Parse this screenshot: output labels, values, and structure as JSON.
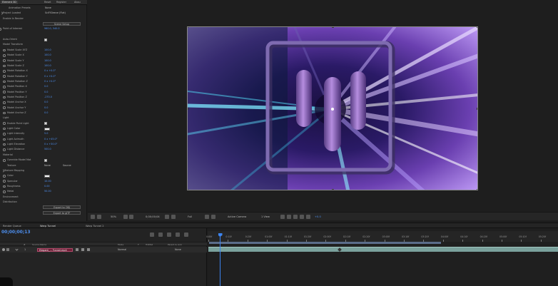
{
  "effect_controls": {
    "tabs": [
      "Element 3D",
      "Reset",
      "Register",
      "Abou"
    ],
    "rows": [
      {
        "label": "Animation Presets",
        "value": "None",
        "style": "white",
        "indent": 10
      },
      {
        "label": "Project Loaded",
        "value": "SciFiSleeve (Flat)",
        "style": "white",
        "indent": 2,
        "twirl": true
      },
      {
        "label": "Enable In Render",
        "value": "",
        "style": "",
        "indent": 2
      },
      {
        "label": "",
        "button": "Scene Setup",
        "indent": 2
      },
      {
        "label": "Point of Interest",
        "value": "960.0, 540.0",
        "style": "blue",
        "indent": 2,
        "stopwatch": true
      },
      {
        "label": "",
        "value": "",
        "style": "",
        "indent": 2
      },
      {
        "label": "Auto-Orient",
        "checkbox": true,
        "indent": 2
      },
      {
        "label": "Model Transform",
        "value": "",
        "style": "",
        "indent": 2
      },
      {
        "label": "Model Scale XYZ",
        "value": "100.0",
        "style": "blue",
        "indent": 8,
        "stopwatch": true
      },
      {
        "label": "Model Scale X",
        "value": "100.0",
        "style": "blue",
        "indent": 8,
        "stopwatch": true
      },
      {
        "label": "Model Scale Y",
        "value": "100.0",
        "style": "blue",
        "indent": 8,
        "stopwatch": true
      },
      {
        "label": "Model Scale Z",
        "value": "100.0",
        "style": "blue",
        "indent": 8,
        "stopwatch": true
      },
      {
        "label": "Model Rotation X",
        "value": "0 x +0.0°",
        "style": "blue",
        "indent": 8,
        "stopwatch": true
      },
      {
        "label": "Model Rotation Y",
        "value": "0 x +0.0°",
        "style": "blue",
        "indent": 8,
        "stopwatch": true
      },
      {
        "label": "Model Rotation Z",
        "value": "0 x +0.0°",
        "style": "blue",
        "indent": 8,
        "stopwatch": true
      },
      {
        "label": "Model Position X",
        "value": "0.0",
        "style": "blue",
        "indent": 8,
        "stopwatch": true
      },
      {
        "label": "Model Position Y",
        "value": "0.0",
        "style": "blue",
        "indent": 8,
        "stopwatch": true
      },
      {
        "label": "Model Position Z",
        "value": "-270.0",
        "style": "blue",
        "indent": 8,
        "stopwatch": true
      },
      {
        "label": "Model Anchor X",
        "value": "0.0",
        "style": "blue",
        "indent": 8,
        "stopwatch": true
      },
      {
        "label": "Model Anchor Y",
        "value": "0.0",
        "style": "blue",
        "indent": 8,
        "stopwatch": true
      },
      {
        "label": "Model Anchor Z",
        "value": "0.0",
        "style": "blue",
        "indent": 8,
        "stopwatch": true
      },
      {
        "label": "Light",
        "value": "",
        "style": "",
        "indent": 2
      },
      {
        "label": "Enable Point Light",
        "checkbox": true,
        "indent": 8,
        "stopwatch": true
      },
      {
        "label": "Light Color",
        "swatch": true,
        "indent": 8,
        "stopwatch": true
      },
      {
        "label": "Light Intensity",
        "value": "5.0",
        "style": "blue",
        "indent": 8,
        "stopwatch": true
      },
      {
        "label": "Light Azimuth",
        "value": "0 x +45.0°",
        "style": "blue",
        "indent": 8,
        "stopwatch": true
      },
      {
        "label": "Light Elevation",
        "value": "0 x +30.0°",
        "style": "blue",
        "indent": 8,
        "stopwatch": true
      },
      {
        "label": "Light Distance",
        "value": "500.0",
        "style": "blue",
        "indent": 8,
        "stopwatch": true
      },
      {
        "label": "Material",
        "value": "",
        "style": "",
        "indent": 2
      },
      {
        "label": "Override Model Mat",
        "checkbox": true,
        "indent": 8,
        "stopwatch": true
      },
      {
        "label": "Texture",
        "dropdowns": [
          "None",
          "Source"
        ],
        "indent": 8
      },
      {
        "label": "Texture Mapping",
        "value": "",
        "style": "",
        "indent": 4,
        "twirl": true
      },
      {
        "label": "Color",
        "swatch": true,
        "indent": 8,
        "stopwatch": true
      },
      {
        "label": "Specular",
        "value": "10.00",
        "style": "blue",
        "indent": 8,
        "stopwatch": true
      },
      {
        "label": "Roughness",
        "value": "0.00",
        "style": "blue",
        "indent": 8,
        "stopwatch": true
      },
      {
        "label": "Metal",
        "value": "50.00",
        "style": "blue",
        "indent": 8,
        "stopwatch": true
      },
      {
        "label": "Environment",
        "value": "",
        "style": "",
        "indent": 2
      },
      {
        "label": "Distribution",
        "value": "",
        "style": "",
        "indent": 2
      },
      {
        "label": "",
        "button": "Export to OBJ",
        "indent": 2
      },
      {
        "label": "",
        "button": "Export to glTF",
        "indent": 2
      }
    ]
  },
  "viewer": {
    "toolbar": {
      "zoom": "50%",
      "timecode": "0;00;00;04",
      "resolution": "Full",
      "camera": "Active Camera",
      "views": "1 View",
      "exposure": "+0.0"
    }
  },
  "timeline": {
    "tabs": [
      "Render Queue",
      "Warp Tunnel",
      "Warp Tunnel 2"
    ],
    "timecode": "00;00;00;13",
    "columns": [
      "#",
      "Source Name",
      "Mode",
      "T",
      "TrkMat",
      "Parent & Link"
    ],
    "layer": {
      "number": "1",
      "name": "Elegant_... Tunnel.mp4",
      "mode": "Normal",
      "trkmat": "",
      "parent": "None"
    },
    "ruler_labels": [
      "0:00f",
      "0:10f",
      "0:20f",
      "01:00f",
      "01:10f",
      "01:20f",
      "02:00f",
      "02:10f",
      "02:20f",
      "03:00f",
      "03:10f",
      "03:20f",
      "04:00f",
      "04:10f",
      "04:20f",
      "05:00f",
      "05:10f",
      "05:20f",
      "06:0"
    ]
  },
  "colors": {
    "accent_blue": "#3c84f0",
    "layer_bar": "#7aa19c",
    "layer_label": "#6f1f37"
  }
}
